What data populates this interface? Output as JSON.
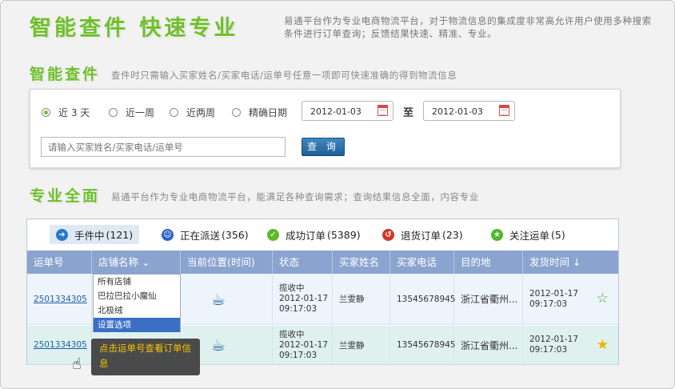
{
  "header": {
    "title": "智能查件  快速专业",
    "description": "易通平台作为专业电商物流平台，对于物流信息的集成度非常高允许用户使用多种搜索条件进行订单查询；反馈结果快速、精准、专业。"
  },
  "search_section": {
    "title": "智能查件",
    "description": "查件时只需输入买家姓名/买家电话/运单号任意一项即可快速准确的得到物流信息",
    "radios": [
      "近 3 天",
      "近一周",
      "近两周",
      "精确日期"
    ],
    "selected_radio": "近 3 天",
    "date_from": "2012-01-03",
    "date_to": "2012-01-03",
    "to_label": "至",
    "query_placeholder": "请输入买家姓名/买家电话/运单号",
    "query_button": "查 询"
  },
  "results_section": {
    "title": "专业全面",
    "description": "易通平台作为专业电商物流平台，能满足各种查询需求；查询结果信息全面，内容专业",
    "tabs": [
      {
        "label": "手件中",
        "count": "(121)",
        "icon": "arrow-right-icon",
        "color": "#2a78c4"
      },
      {
        "label": "正在派送",
        "count": "(356)",
        "icon": "smile-icon",
        "color": "#2a60c4"
      },
      {
        "label": "成功订单",
        "count": "(5389)",
        "icon": "check-icon",
        "color": "#5fb82a"
      },
      {
        "label": "退货订单",
        "count": "(23)",
        "icon": "return-icon",
        "color": "#d0352d"
      },
      {
        "label": "关注运单",
        "count": "(5)",
        "icon": "star-icon",
        "color": "#4cb82a"
      }
    ],
    "columns": [
      "运单号",
      "店铺名称",
      "当前位置(时间)",
      "状态",
      "买家姓名",
      "买家电话",
      "目的地",
      "发货时间 ↓"
    ],
    "rows": [
      {
        "waybill": "2501334305",
        "status": [
          "揽收中",
          "2012-01-17",
          "09:17:03"
        ],
        "buyer": "兰雯静",
        "phone": "13545678945",
        "destination": "浙江省衢州...",
        "ship_time": [
          "2012-01-17",
          "09:17:03"
        ],
        "starred": false
      },
      {
        "waybill": "2501334305",
        "status": [
          "揽收中",
          "2012-01-17",
          "09:17:03"
        ],
        "buyer": "兰雯静",
        "phone": "13545678945",
        "destination": "浙江省衢州...",
        "ship_time": [
          "2012-01-17",
          "09:17:03"
        ],
        "starred": true
      }
    ],
    "store_dropdown": [
      "所有店铺",
      "巴拉巴拉小魔仙",
      "北极绒",
      "设置选项"
    ],
    "store_dropdown_selected": "设置选项",
    "tooltip": "点击运单号查看订单信息"
  }
}
